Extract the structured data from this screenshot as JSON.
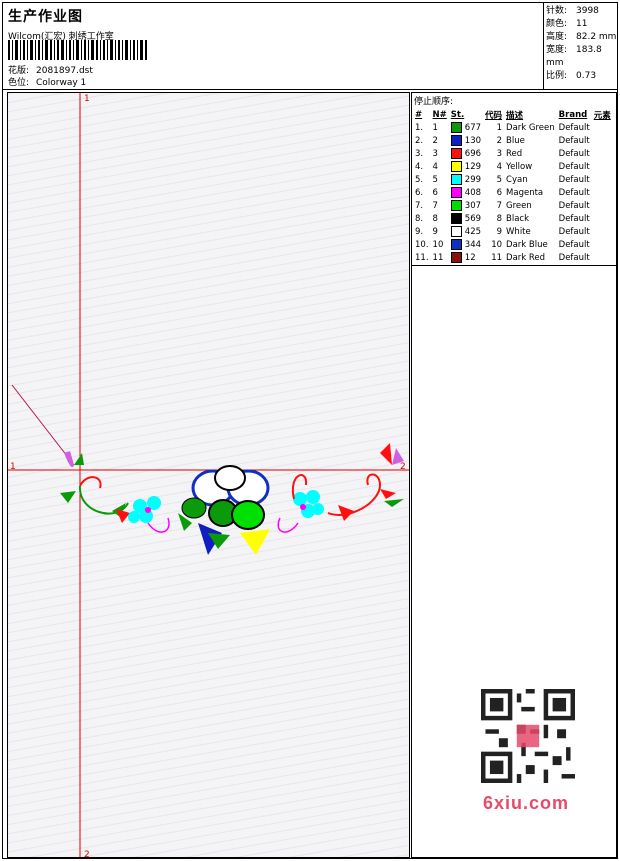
{
  "header": {
    "title": "生产作业图",
    "studio": "Wilcom(汇宏) 刺绣工作室",
    "design_label": "花版:",
    "design_value": "2081897.dst",
    "colorway_label": "色位:",
    "colorway_value": "Colorway 1"
  },
  "stats": {
    "stitches_label": "针数:",
    "stitches_value": "3998",
    "colors_label": "颜色:",
    "colors_value": "11",
    "height_label": "高度:",
    "height_value": "82.2 mm",
    "width_label": "宽度:",
    "width_value": "183.8 mm",
    "scale_label": "比例:",
    "scale_value": "0.73"
  },
  "stop_sequence": {
    "heading": "停止顺序:",
    "columns": [
      "#",
      "N#",
      "St.",
      "代码",
      "描述",
      "Brand",
      "元素"
    ],
    "rows": [
      {
        "idx": "1.",
        "n": "1",
        "color": "#0a9a0a",
        "st": "677",
        "code": "1",
        "desc": "Dark Green",
        "brand": "Default"
      },
      {
        "idx": "2.",
        "n": "2",
        "color": "#1020c0",
        "st": "130",
        "code": "2",
        "desc": "Blue",
        "brand": "Default"
      },
      {
        "idx": "3.",
        "n": "3",
        "color": "#ff1010",
        "st": "696",
        "code": "3",
        "desc": "Red",
        "brand": "Default"
      },
      {
        "idx": "4.",
        "n": "4",
        "color": "#ffff00",
        "st": "129",
        "code": "4",
        "desc": "Yellow",
        "brand": "Default"
      },
      {
        "idx": "5.",
        "n": "5",
        "color": "#00ffff",
        "st": "299",
        "code": "5",
        "desc": "Cyan",
        "brand": "Default"
      },
      {
        "idx": "6.",
        "n": "6",
        "color": "#ff00ff",
        "st": "408",
        "code": "6",
        "desc": "Magenta",
        "brand": "Default"
      },
      {
        "idx": "7.",
        "n": "7",
        "color": "#00e000",
        "st": "307",
        "code": "7",
        "desc": "Green",
        "brand": "Default"
      },
      {
        "idx": "8.",
        "n": "8",
        "color": "#000000",
        "st": "569",
        "code": "8",
        "desc": "Black",
        "brand": "Default"
      },
      {
        "idx": "9.",
        "n": "9",
        "color": "#ffffff",
        "st": "425",
        "code": "9",
        "desc": "White",
        "brand": "Default"
      },
      {
        "idx": "10.",
        "n": "10",
        "color": "#1030c0",
        "st": "344",
        "code": "10",
        "desc": "Dark Blue",
        "brand": "Default"
      },
      {
        "idx": "11.",
        "n": "11",
        "color": "#8a1010",
        "st": "12",
        "code": "11",
        "desc": "Dark Red",
        "brand": "Default"
      }
    ]
  },
  "canvas": {
    "axis_labels": {
      "left": "1",
      "right": "2",
      "top": "1",
      "bottom": "2"
    },
    "guide_color": "#dd0000"
  },
  "watermark": {
    "site": "6xiu.com"
  }
}
